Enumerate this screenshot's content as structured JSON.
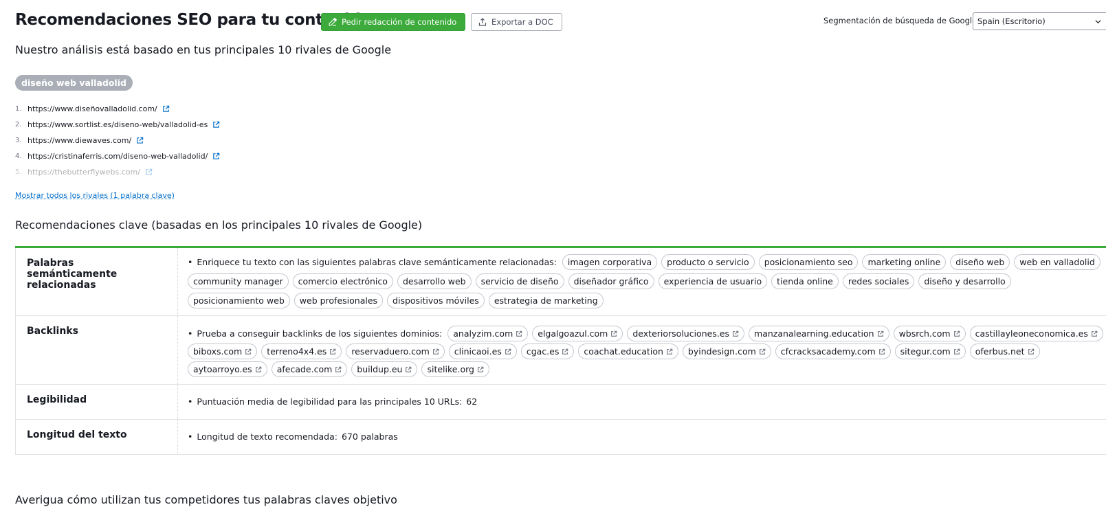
{
  "header": {
    "title": "Recomendaciones SEO para tu contenido",
    "order_button": "Pedir redacción de contenido",
    "export_button": "Exportar a DOC",
    "segmentation_label": "Segmentación de búsqueda de Google:",
    "segmentation_value": "Spain (Escritorio)"
  },
  "analysis_subtitle": "Nuestro análisis está basado en tus principales 10 rivales de Google",
  "keyword_badge": "diseño web valladolid",
  "rivals": [
    {
      "num": "1.",
      "url": "https://www.diseñovalladolid.com/"
    },
    {
      "num": "2.",
      "url": "https://www.sortlist.es/diseno-web/valladolid-es"
    },
    {
      "num": "3.",
      "url": "https://www.diewaves.com/"
    },
    {
      "num": "4.",
      "url": "https://cristinaferris.com/diseno-web-valladolid/"
    },
    {
      "num": "5.",
      "url": "https://thebutterflywebs.com/"
    }
  ],
  "show_all_link": "Mostrar todos los rivales (1 palabra clave)",
  "recommendations_title": "Recomendaciones clave (basadas en los principales 10 rivales de Google)",
  "recommendations": {
    "semantic": {
      "label": "Palabras semánticamente relacionadas",
      "lead": "Enriquece tu texto con las siguientes palabras clave semánticamente relacionadas:",
      "chips": [
        "imagen corporativa",
        "producto o servicio",
        "posicionamiento seo",
        "marketing online",
        "diseño web",
        "web en valladolid",
        "community manager",
        "comercio electrónico",
        "desarrollo web",
        "servicio de diseño",
        "diseñador gráfico",
        "experiencia de usuario",
        "tienda online",
        "redes sociales",
        "diseño y desarrollo",
        "posicionamiento web",
        "web profesionales",
        "dispositivos móviles",
        "estrategia de marketing"
      ]
    },
    "backlinks": {
      "label": "Backlinks",
      "lead": "Prueba a conseguir backlinks de los siguientes dominios:",
      "chips": [
        "analyzim.com",
        "elgalgoazul.com",
        "dexteriorsoluciones.es",
        "manzanalearning.education",
        "wbsrch.com",
        "castillayleoneconomica.es",
        "biboxs.com",
        "terreno4x4.es",
        "reservaduero.com",
        "clinicaoi.es",
        "cgac.es",
        "coachat.education",
        "byindesign.com",
        "cfcracksacademy.com",
        "sitegur.com",
        "oferbus.net",
        "aytoarroyo.es",
        "afecade.com",
        "buildup.eu",
        "sitelike.org"
      ]
    },
    "readability": {
      "label": "Legibilidad",
      "lead": "Puntuación media de legibilidad para las principales 10 URLs:",
      "value": "62"
    },
    "length": {
      "label": "Longitud del texto",
      "lead": "Longitud de texto recomendada:",
      "value": "670 palabras"
    }
  },
  "competitors_title": "Averigua cómo utilizan tus competidores tus palabras claves objetivo",
  "colors": {
    "accent_green": "#3cab3c",
    "link_blue": "#006dca"
  }
}
